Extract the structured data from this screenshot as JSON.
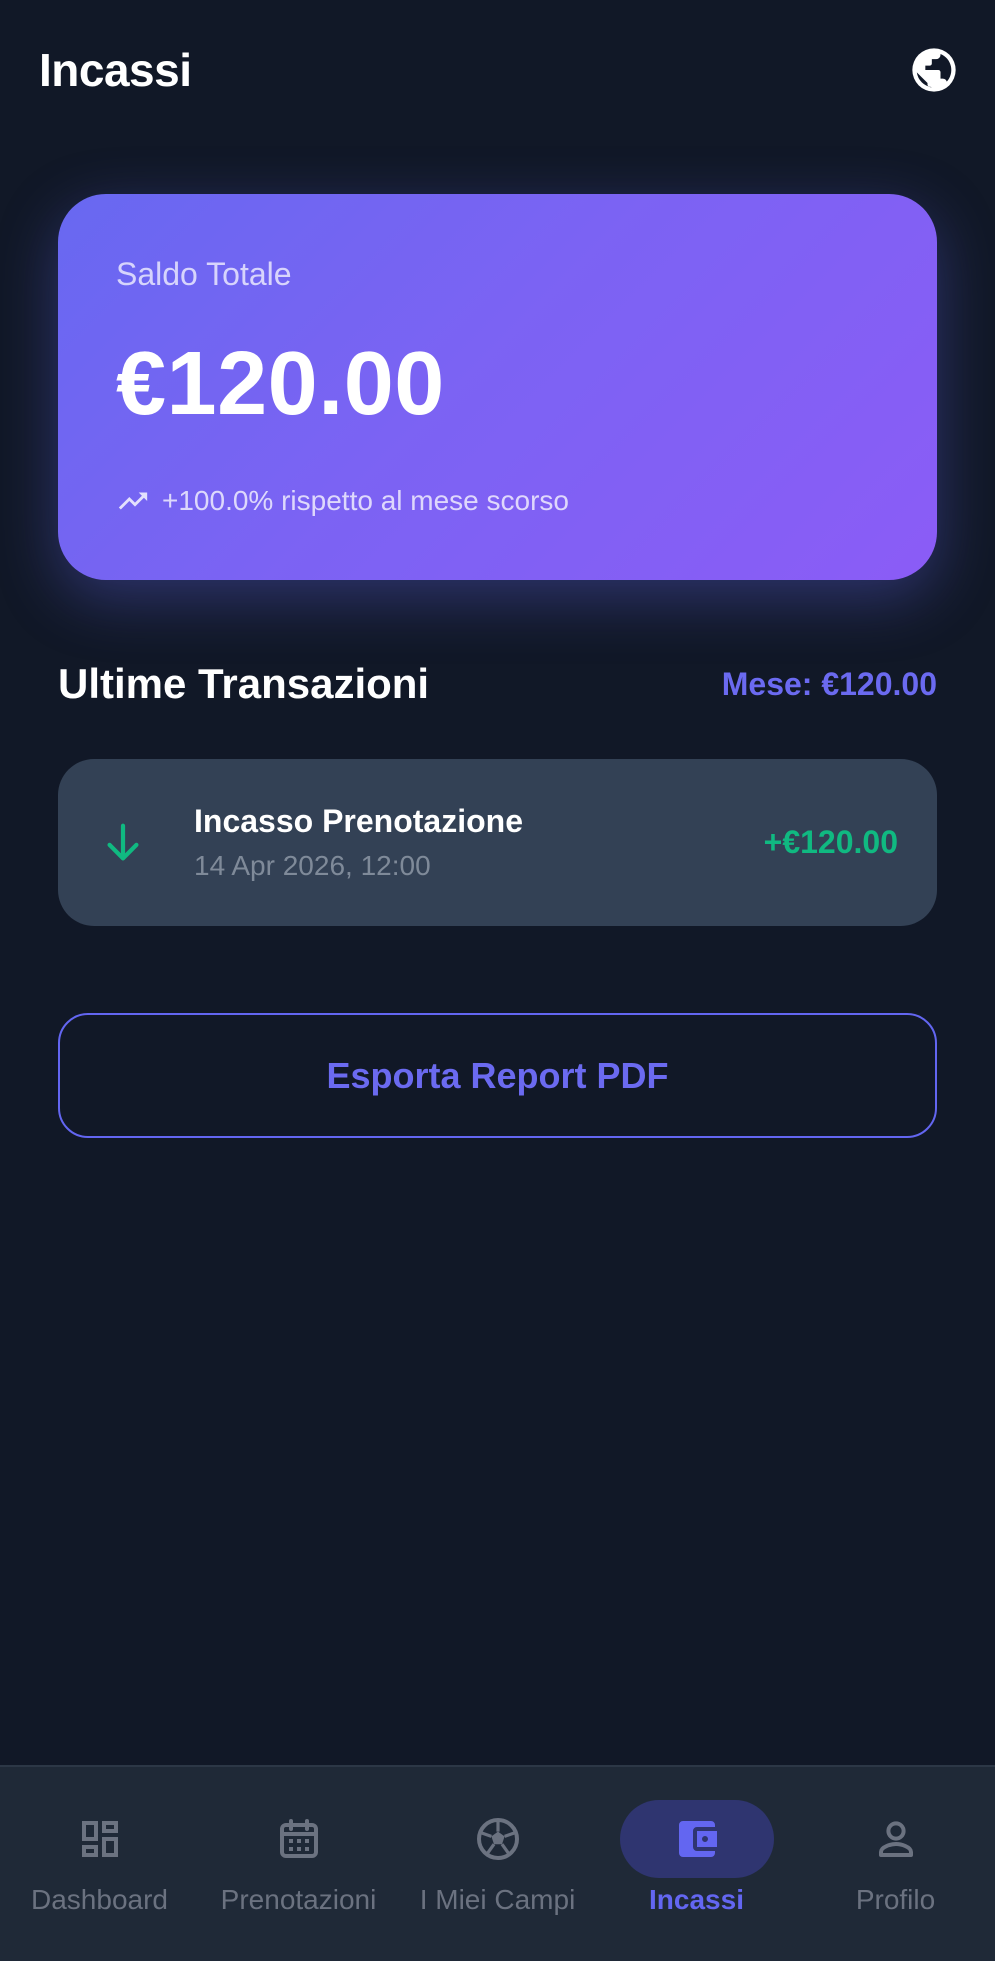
{
  "header": {
    "title": "Incassi",
    "language_icon": "globe-icon"
  },
  "balance": {
    "label": "Saldo Totale",
    "amount": "€120.00",
    "trend_icon": "trending-up-icon",
    "trend_text": "+100.0% rispetto al mese scorso"
  },
  "transactions": {
    "title": "Ultime Transazioni",
    "month_total": "Mese: €120.00",
    "items": [
      {
        "icon": "arrow-down-icon",
        "title": "Incasso Prenotazione",
        "date": "14 Apr 2026, 12:00",
        "amount": "+€120.00"
      }
    ]
  },
  "export": {
    "label": "Esporta Report PDF"
  },
  "nav": {
    "items": [
      {
        "label": "Dashboard",
        "icon": "dashboard-icon",
        "active": false
      },
      {
        "label": "Prenotazioni",
        "icon": "calendar-icon",
        "active": false
      },
      {
        "label": "I Miei Campi",
        "icon": "soccer-ball-icon",
        "active": false
      },
      {
        "label": "Incassi",
        "icon": "wallet-icon",
        "active": true
      },
      {
        "label": "Profilo",
        "icon": "person-icon",
        "active": false
      }
    ]
  },
  "colors": {
    "background": "#111827",
    "accent": "#6366f1",
    "success": "#10b981",
    "card": "#334155",
    "nav_background": "#1f2937",
    "muted": "#6b7280"
  }
}
